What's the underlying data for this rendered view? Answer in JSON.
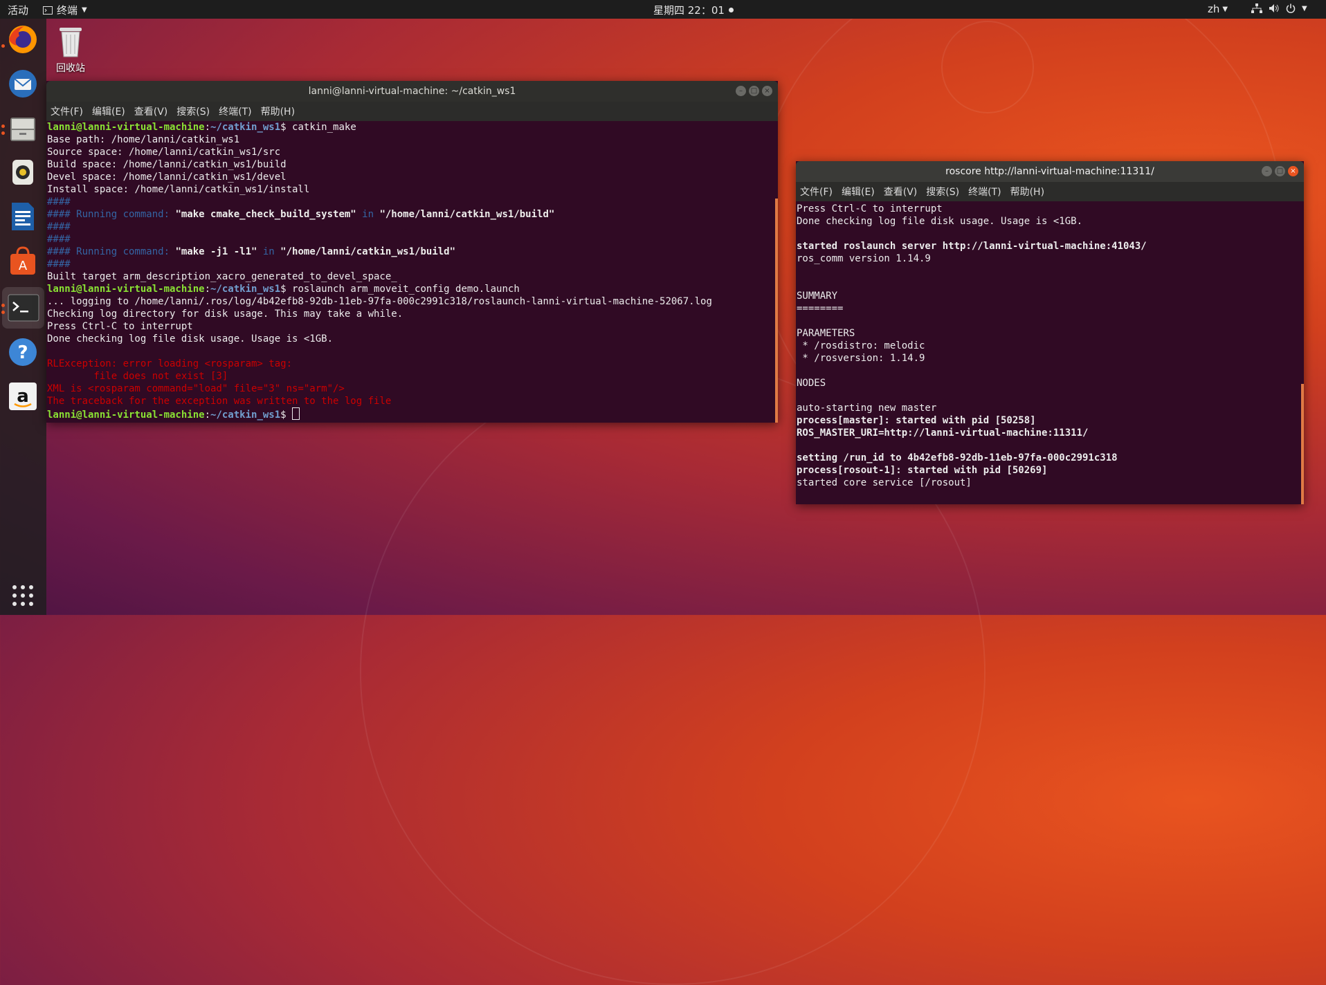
{
  "topbar": {
    "activities": "活动",
    "app_menu": "终端",
    "clock": "星期四 22：01",
    "lang": "zh"
  },
  "desktop": {
    "trash_label": "回收站"
  },
  "dock": {
    "items": [
      "firefox-icon",
      "thunderbird-icon",
      "files-icon",
      "rhythmbox-icon",
      "writer-icon",
      "software-icon",
      "terminal-icon",
      "help-icon",
      "amazon-icon"
    ],
    "show_apps": "show-applications-icon"
  },
  "term1": {
    "title": "lanni@lanni-virtual-machine: ~/catkin_ws1",
    "menu": [
      "文件(F)",
      "编辑(E)",
      "查看(V)",
      "搜索(S)",
      "终端(T)",
      "帮助(H)"
    ],
    "lines": [
      [
        [
          "g",
          "lanni@lanni-virtual-machine"
        ],
        [
          "n",
          ":"
        ],
        [
          "b",
          "~/catkin_ws1"
        ],
        [
          "n",
          "$ catkin_make"
        ]
      ],
      [
        [
          "n",
          "Base path: /home/lanni/catkin_ws1"
        ]
      ],
      [
        [
          "n",
          "Source space: /home/lanni/catkin_ws1/src"
        ]
      ],
      [
        [
          "n",
          "Build space: /home/lanni/catkin_ws1/build"
        ]
      ],
      [
        [
          "n",
          "Devel space: /home/lanni/catkin_ws1/devel"
        ]
      ],
      [
        [
          "n",
          "Install space: /home/lanni/catkin_ws1/install"
        ]
      ],
      [
        [
          "bl",
          "####"
        ]
      ],
      [
        [
          "bl",
          "#### Running command: "
        ],
        [
          "wb",
          "\"make cmake_check_build_system\""
        ],
        [
          "bl",
          " in "
        ],
        [
          "wb",
          "\"/home/lanni/catkin_ws1/build\""
        ]
      ],
      [
        [
          "bl",
          "####"
        ]
      ],
      [
        [
          "bl",
          "####"
        ]
      ],
      [
        [
          "bl",
          "#### Running command: "
        ],
        [
          "wb",
          "\"make -j1 -l1\""
        ],
        [
          "bl",
          " in "
        ],
        [
          "wb",
          "\"/home/lanni/catkin_ws1/build\""
        ]
      ],
      [
        [
          "bl",
          "####"
        ]
      ],
      [
        [
          "n",
          "Built target arm_description_xacro_generated_to_devel_space_"
        ]
      ],
      [
        [
          "g",
          "lanni@lanni-virtual-machine"
        ],
        [
          "n",
          ":"
        ],
        [
          "b",
          "~/catkin_ws1"
        ],
        [
          "n",
          "$ roslaunch arm_moveit_config demo.launch"
        ]
      ],
      [
        [
          "n",
          "... logging to /home/lanni/.ros/log/4b42efb8-92db-11eb-97fa-000c2991c318/roslaunch-lanni-virtual-machine-52067.log"
        ]
      ],
      [
        [
          "n",
          "Checking log directory for disk usage. This may take a while."
        ]
      ],
      [
        [
          "n",
          "Press Ctrl-C to interrupt"
        ]
      ],
      [
        [
          "n",
          "Done checking log file disk usage. Usage is <1GB."
        ]
      ],
      [
        [
          "n",
          ""
        ]
      ],
      [
        [
          "r",
          "RLException: error loading <rosparam> tag:"
        ]
      ],
      [
        [
          "r",
          "        file does not exist [3]"
        ]
      ],
      [
        [
          "r",
          "XML is <rosparam command=\"load\" file=\"3\" ns=\"arm\"/>"
        ]
      ],
      [
        [
          "r",
          "The traceback for the exception was written to the log file"
        ]
      ],
      [
        [
          "g",
          "lanni@lanni-virtual-machine"
        ],
        [
          "n",
          ":"
        ],
        [
          "b",
          "~/catkin_ws1"
        ],
        [
          "n",
          "$ "
        ],
        [
          "cursor",
          ""
        ]
      ]
    ]
  },
  "term2": {
    "title": "roscore http://lanni-virtual-machine:11311/",
    "menu": [
      "文件(F)",
      "编辑(E)",
      "查看(V)",
      "搜索(S)",
      "终端(T)",
      "帮助(H)"
    ],
    "lines": [
      [
        [
          "n",
          "Press Ctrl-C to interrupt"
        ]
      ],
      [
        [
          "n",
          "Done checking log file disk usage. Usage is <1GB."
        ]
      ],
      [
        [
          "n",
          ""
        ]
      ],
      [
        [
          "bold",
          "started roslaunch server http://lanni-virtual-machine:41043/"
        ]
      ],
      [
        [
          "n",
          "ros_comm version 1.14.9"
        ]
      ],
      [
        [
          "n",
          ""
        ]
      ],
      [
        [
          "n",
          ""
        ]
      ],
      [
        [
          "n",
          "SUMMARY"
        ]
      ],
      [
        [
          "n",
          "========"
        ]
      ],
      [
        [
          "n",
          ""
        ]
      ],
      [
        [
          "n",
          "PARAMETERS"
        ]
      ],
      [
        [
          "n",
          " * /rosdistro: melodic"
        ]
      ],
      [
        [
          "n",
          " * /rosversion: 1.14.9"
        ]
      ],
      [
        [
          "n",
          ""
        ]
      ],
      [
        [
          "n",
          "NODES"
        ]
      ],
      [
        [
          "n",
          ""
        ]
      ],
      [
        [
          "n",
          "auto-starting new master"
        ]
      ],
      [
        [
          "bold",
          "process[master]: started with pid [50258]"
        ]
      ],
      [
        [
          "bold",
          "ROS_MASTER_URI=http://lanni-virtual-machine:11311/"
        ]
      ],
      [
        [
          "n",
          ""
        ]
      ],
      [
        [
          "bold",
          "setting /run_id to 4b42efb8-92db-11eb-97fa-000c2991c318"
        ]
      ],
      [
        [
          "bold",
          "process[rosout-1]: started with pid [50269]"
        ]
      ],
      [
        [
          "n",
          "started core service [/rosout]"
        ]
      ]
    ]
  }
}
